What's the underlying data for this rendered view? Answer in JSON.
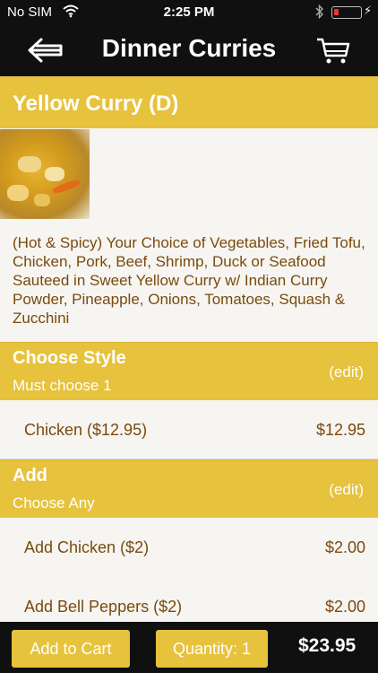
{
  "status": {
    "carrier": "No SIM",
    "time": "2:25 PM",
    "battery_color": "#e33333"
  },
  "nav": {
    "back_icon": "left-arrow-icon",
    "title": "Dinner Curries",
    "cart_icon": "shopping-cart-icon"
  },
  "item": {
    "title": "Yellow Curry (D)",
    "image": "yellow-curry-photo",
    "description": "(Hot & Spicy) Your Choice of Vegetables, Fried Tofu, Chicken, Pork, Beef, Shrimp, Duck or Seafood Sauteed in Sweet Yellow Curry w/ Indian Curry Powder, Pineapple, Onions, Tomatoes, Squash & Zucchini"
  },
  "sections": [
    {
      "title": "Choose Style",
      "subtitle": "Must choose 1",
      "edit_label": "(edit)",
      "options": [
        {
          "label": "Chicken ($12.95)",
          "price": "$12.95"
        }
      ]
    },
    {
      "title": "Add",
      "subtitle": "Choose Any",
      "edit_label": "(edit)",
      "options": [
        {
          "label": "Add Chicken ($2)",
          "price": "$2.00"
        },
        {
          "label": "Add Bell Peppers ($2)",
          "price": "$2.00"
        }
      ]
    }
  ],
  "footer": {
    "add_to_cart_label": "Add to Cart",
    "quantity_label": "Quantity: 1",
    "total": "$23.95"
  },
  "colors": {
    "accent": "#e6c23d",
    "text_brown": "#7a4a0c",
    "bar_background": "#101010",
    "content_background": "#f6f5f2"
  }
}
